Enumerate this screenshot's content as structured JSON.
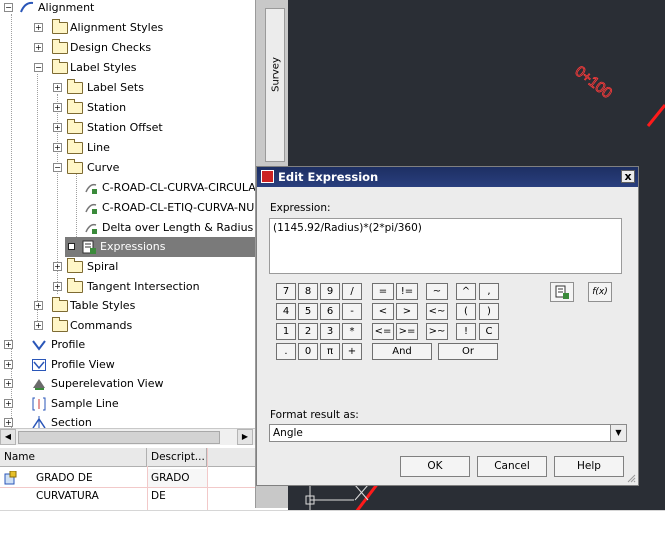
{
  "tree": {
    "items": [
      {
        "label": "Alignment"
      },
      {
        "label": "Alignment Styles"
      },
      {
        "label": "Design Checks"
      },
      {
        "label": "Label Styles"
      },
      {
        "label": "Label Sets"
      },
      {
        "label": "Station"
      },
      {
        "label": "Station Offset"
      },
      {
        "label": "Line"
      },
      {
        "label": "Curve"
      },
      {
        "label": "C-ROAD-CL-CURVA-CIRCULAR"
      },
      {
        "label": "C-ROAD-CL-ETIQ-CURVA-NUM"
      },
      {
        "label": "Delta over Length & Radius"
      },
      {
        "label": "Expressions"
      },
      {
        "label": "Spiral"
      },
      {
        "label": "Tangent Intersection"
      },
      {
        "label": "Table Styles"
      },
      {
        "label": "Commands"
      },
      {
        "label": "Profile"
      },
      {
        "label": "Profile View"
      },
      {
        "label": "Superelevation View"
      },
      {
        "label": "Sample Line"
      },
      {
        "label": "Section"
      }
    ]
  },
  "list": {
    "columns": [
      "Name",
      "Descript..."
    ],
    "rows": [
      {
        "name": "GRADO DE CURVATURA",
        "description": "GRADO DE"
      }
    ]
  },
  "survey_tab": {
    "label": "Survey"
  },
  "canvas": {
    "station_label": "0+100"
  },
  "dialog": {
    "title": "Edit Expression",
    "close_glyph": "x",
    "expression_label": "Expression:",
    "expression_value": "(1145.92/Radius)*(2*pi/360)",
    "keypad": {
      "digits": [
        "7",
        "8",
        "9",
        "/",
        "4",
        "5",
        "6",
        "-",
        "1",
        "2",
        "3",
        "*",
        ".",
        "0",
        "π",
        "+"
      ],
      "ops": [
        "=",
        "!=",
        "<",
        ">",
        "<=",
        ">="
      ],
      "misc": [
        "~",
        "<~",
        ">~"
      ],
      "misc2": [
        "^",
        ",",
        "(",
        ")",
        "!",
        "C"
      ],
      "and_label": "And",
      "or_label": "Or"
    },
    "insert_property_label": "insert-property-icon",
    "insert_function_label": "f(x)",
    "format_label": "Format result as:",
    "format_value": "Angle",
    "ok_label": "OK",
    "cancel_label": "Cancel",
    "help_label": "Help"
  },
  "colors": {
    "selection": "#7a7a7a",
    "titlebar": "#233672",
    "canvas": "#2a2e35",
    "alignment_line": "#ff1a1a"
  }
}
